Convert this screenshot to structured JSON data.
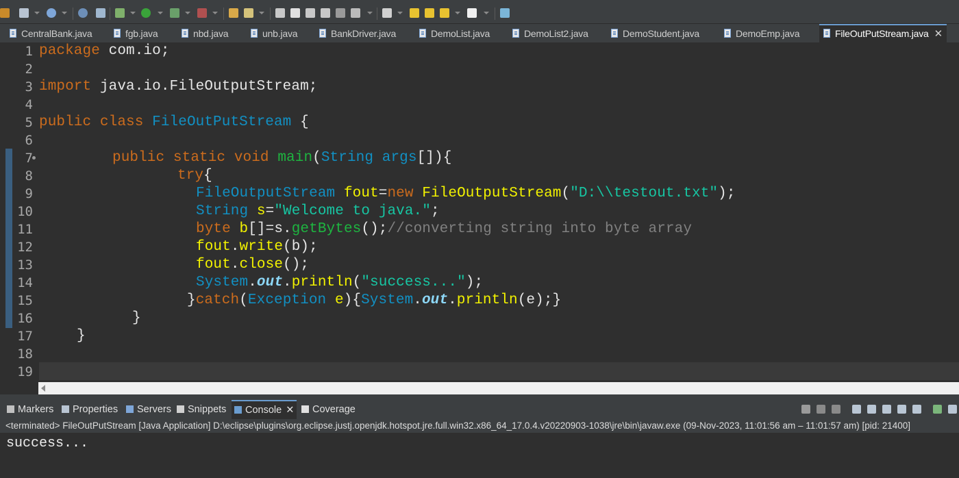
{
  "toolbar": {
    "icons": [
      "new-icon",
      "save-icon",
      "globe-icon",
      "gear-icon",
      "debug-icon",
      "run-icon",
      "external-tools-icon",
      "coverage-icon",
      "open-type-icon",
      "search-icon",
      "annotation-icon",
      "toggle-icon",
      "block-selection-icon",
      "whitespace-icon",
      "next-annotation-icon",
      "prev-annotation-icon",
      "last-edit-icon",
      "back-icon",
      "forward-icon",
      "pin-icon"
    ]
  },
  "editor_tabs": [
    {
      "label": "CentralBank.java"
    },
    {
      "label": "fgb.java"
    },
    {
      "label": "nbd.java"
    },
    {
      "label": "unb.java"
    },
    {
      "label": "BankDriver.java"
    },
    {
      "label": "DemoList.java"
    },
    {
      "label": "DemoList2.java"
    },
    {
      "label": "DemoStudent.java"
    },
    {
      "label": "DemoEmp.java"
    },
    {
      "label": "FileOutPutStream.java",
      "active": true,
      "close": "✕"
    }
  ],
  "code": {
    "line_numbers": [
      "1",
      "2",
      "3",
      "4",
      "5",
      "6",
      "7",
      "8",
      "9",
      "10",
      "11",
      "12",
      "13",
      "14",
      "15",
      "16",
      "17",
      "18",
      "19"
    ],
    "l1_kw": "package",
    "l1_rest": " com.io;",
    "l3_kw": "import",
    "l3_rest": " java.io.FileOutputStream;",
    "l5_kw": "public class",
    "l5_type": "FileOutPutStream",
    "l5_rest": " {",
    "l7_kw": "public static void",
    "l7_mth": "main",
    "l7_p1": "(",
    "l7_type": "String",
    "l7_var": "args",
    "l7_p2": "[]){",
    "l8_kw": "try",
    "l8_rest": "{",
    "l9_type1": "FileOutputStream",
    "l9_var": "fout",
    "l9_eq": "=",
    "l9_new": "new",
    "l9_type2": "FileOutputStream",
    "l9_p1": "(",
    "l9_str": "\"D:\\\\testout.txt\"",
    "l9_p2": ");",
    "l10_type": "String",
    "l10_var": "s",
    "l10_eq": "=",
    "l10_str": "\"Welcome to java.\"",
    "l10_end": ";",
    "l11_kw": "byte",
    "l11_var": "b",
    "l11_a": "[]=s.",
    "l11_mth": "getBytes",
    "l11_b": "();",
    "l11_cmt": "//converting string into byte array",
    "l12_var": "fout",
    "l12_dot": ".",
    "l12_mth": "write",
    "l12_rest": "(b);",
    "l13_var": "fout",
    "l13_dot": ".",
    "l13_mth": "close",
    "l13_rest": "();",
    "l14_type": "System",
    "l14_dot1": ".",
    "l14_fld": "out",
    "l14_dot2": ".",
    "l14_mth": "println",
    "l14_p1": "(",
    "l14_str": "\"success...\"",
    "l14_p2": ");",
    "l15_b": "}",
    "l15_kw": "catch",
    "l15_p1": "(",
    "l15_type": "Exception",
    "l15_var": "e",
    "l15_p2": "){",
    "l15_type2": "System",
    "l15_dot1": ".",
    "l15_fld": "out",
    "l15_dot2": ".",
    "l15_mth": "println",
    "l15_p3": "(e);}",
    "l16": "}",
    "l17": "}"
  },
  "views": {
    "tabs": [
      {
        "label": "Markers"
      },
      {
        "label": "Properties"
      },
      {
        "label": "Servers"
      },
      {
        "label": "Snippets"
      },
      {
        "label": "Console",
        "active": true,
        "close": "✕"
      },
      {
        "label": "Coverage"
      }
    ]
  },
  "console": {
    "status": "<terminated> FileOutPutStream [Java Application] D:\\eclipse\\plugins\\org.eclipse.justj.openjdk.hotspot.jre.full.win32.x86_64_17.0.4.v20220903-1038\\jre\\bin\\javaw.exe  (09-Nov-2023, 11:01:56 am – 11:01:57 am) [pid: 21400]",
    "output": "success..."
  },
  "colors": {
    "keyword": "#cc6c1d",
    "type": "#1290c3",
    "variable": "#f2f200",
    "method": "#1eb540",
    "string": "#17c6a3",
    "comment": "#808080",
    "field": "#8dd8f8",
    "background": "#2f2f2f"
  }
}
